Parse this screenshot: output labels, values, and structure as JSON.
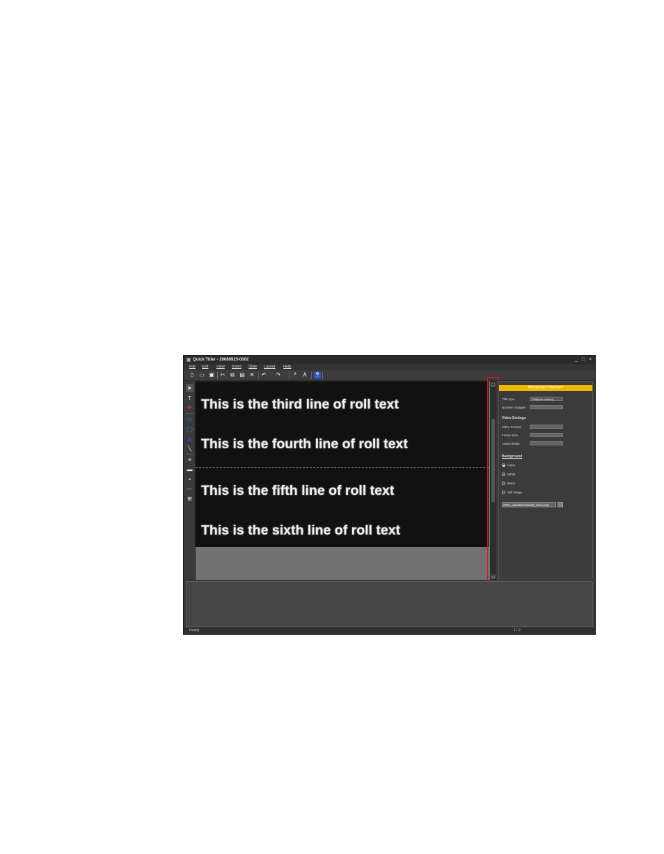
{
  "window": {
    "title": "Quick Titler - 20080925-0002",
    "controls": [
      "_",
      "□",
      "×"
    ]
  },
  "menu": [
    "File",
    "Edit",
    "View",
    "Insert",
    "Style",
    "Layout",
    "Help"
  ],
  "toolbar": {
    "icons": [
      "new-icon",
      "open-icon",
      "save-icon",
      "cut-icon",
      "copy-icon",
      "paste-icon",
      "delete-icon",
      "undo-icon",
      "redo-icon",
      "style-icon",
      "text-style-icon",
      "help-icon"
    ],
    "help_label": "?"
  },
  "tools": [
    "select-tool",
    "text-tool",
    "position-tool",
    "rectangle-tool",
    "ellipse-tool",
    "triangle-tool",
    "line-tool",
    "align-tool",
    "layer-tool",
    "image-tool",
    "grid-tool",
    "table-tool"
  ],
  "canvas": {
    "lines": [
      "This is the third line of roll text",
      "This is the fourth line of roll text",
      "This is the fifth line of roll text",
      "This is the sixth line of roll text"
    ]
  },
  "properties": {
    "header": "Background Properties",
    "title_type_label": "Title type",
    "title_type_value": "Roll(from bottom)",
    "pages_label": "Number of pages",
    "pages_value": "",
    "video_settings": "Video Settings",
    "video_format_label": "Video Format",
    "video_format_value": "",
    "frame_size_label": "Frame Size",
    "frame_size_value": "",
    "aspect_ratio_label": "Aspect Ratio",
    "aspect_ratio_value": "",
    "background_section": "Background",
    "bg_options": [
      "Video",
      "White",
      "Black",
      "Still Image"
    ],
    "bg_selected": "Video",
    "file_value": "2026_wasd02\\wasd02_back.png",
    "browse_label": "..."
  },
  "status": {
    "text": "Ready",
    "page": "1 / 2"
  },
  "colors": {
    "accent": "#f2b705",
    "highlight": "#e11111",
    "canvas_bg": "#111111"
  }
}
